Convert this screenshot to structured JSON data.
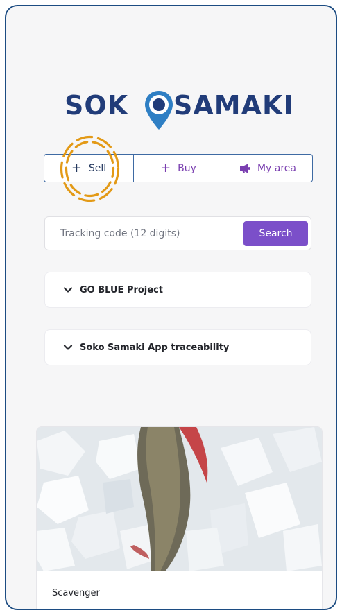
{
  "logo": {
    "left_text": "SOK",
    "right_text": "SAMAKI",
    "pin_icon": "location-pin-icon",
    "color_primary": "#213c79",
    "color_accent": "#2f7fc4"
  },
  "tabs": [
    {
      "label": "Sell",
      "icon": "plus-icon"
    },
    {
      "label": "Buy",
      "icon": "plus-icon"
    },
    {
      "label": "My area",
      "icon": "megaphone-icon"
    }
  ],
  "search": {
    "placeholder": "Tracking code (12 digits)",
    "value": "",
    "button_label": "Search"
  },
  "accordions": [
    {
      "label": "GO BLUE Project",
      "icon": "chevron-down-icon"
    },
    {
      "label": "Soko Samaki App traceability",
      "icon": "chevron-down-icon"
    }
  ],
  "card": {
    "title": "Scavenger",
    "image": "fish-on-ice-image"
  },
  "colors": {
    "frame_border": "#1c4c82",
    "tab_border": "#3e6aa3",
    "tab_text": "#7a3fb0",
    "search_button": "#7b4fc9",
    "highlight": "#e39a17"
  }
}
